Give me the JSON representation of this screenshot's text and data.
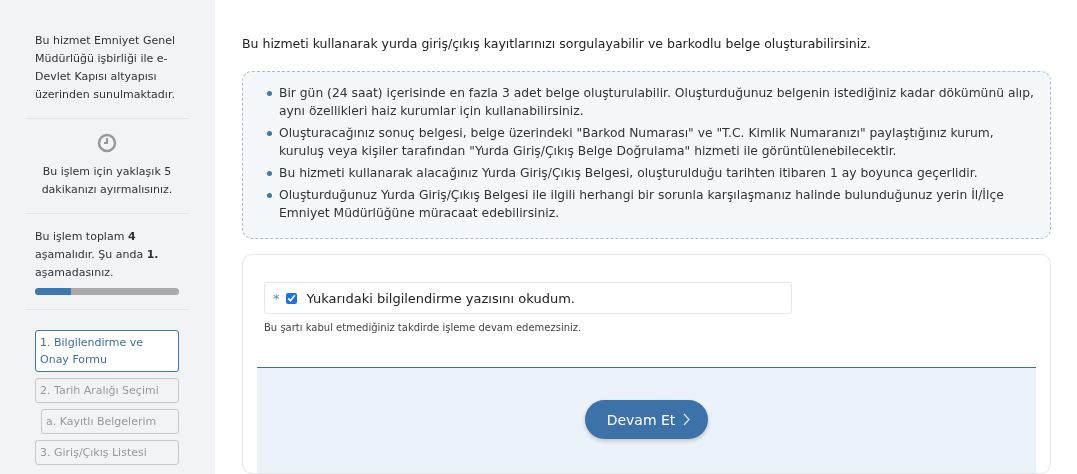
{
  "sidebar": {
    "service_note": "Bu hizmet Emniyet Genel Müdürlüğü işbirliği ile e-Devlet Kapısı altyapısı üzerinden sunulmaktadır.",
    "time_note": "Bu işlem için yaklaşık 5 dakikanızı ayırmalısınız.",
    "stage_note": "Bu işlem toplam **4** aşamalıdır. Şu anda **1.** aşamadasınız.",
    "progress": {
      "level": 0.25
    },
    "steps": [
      {
        "label": "1. Bilgilendirme ve Onay Formu",
        "selected": true
      },
      {
        "label": "2. Tarih Aralığı Seçimi",
        "selected": false,
        "children": [
          {
            "label": "a. Kayıtlı Belgelerim",
            "selected": false
          }
        ]
      },
      {
        "label": "3. Giriş/Çıkış Listesi",
        "selected": false
      }
    ]
  },
  "intro": "Bu hizmeti kullanarak yurda giriş/çıkış kayıtlarınızı sorgulayabilir ve barkodlu belge oluşturabilirsiniz.",
  "info_items": [
    "Bir gün (24 saat) içerisinde en fazla 3 adet belge oluşturulabilir. Oluşturduğunuz belgenin istediğiniz kadar dökümünü alıp, aynı özellikleri haiz kurumlar için kullanabilirsiniz.",
    "Oluşturacağınız sonuç belgesi, belge üzerindeki \"Barkod Numarası\" ve \"T.C. Kimlik Numaranızı\" paylaştığınız kurum, kuruluş veya kişiler tarafından \"Yurda Giriş/Çıkış Belge Doğrulama\" hizmeti ile görüntülenebilecektir.",
    "Bu hizmeti kullanarak alacağınız Yurda Giriş/Çıkış Belgesi, oluşturulduğu tarihten itibaren 1 ay boyunca geçerlidir.",
    "Oluşturduğunuz Yurda Giriş/Çıkış Belgesi ile ilgili herhangi bir sorunla karşılaşmanız halinde bulunduğunuz yerin İl/İlçe Emniyet Müdürlüğüne müracaat edebilirsiniz."
  ],
  "form": {
    "required_mark": "*",
    "agreement": {
      "label": "Yukarıdaki bilgilendirme yazısını okudum.",
      "checked": true
    },
    "hint": "Bu şartı kabul etmediğiniz takdirde işleme devam edemezsiniz.",
    "submit": "Devam Et"
  }
}
